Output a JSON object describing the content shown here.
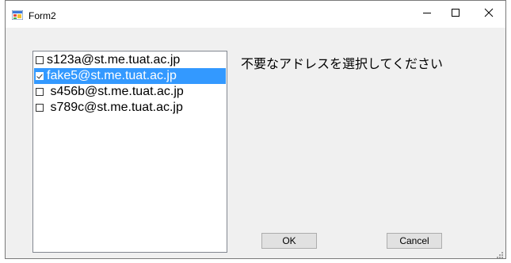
{
  "window": {
    "title": "Form2",
    "minimize_symbol": "–",
    "close_symbol": "✕"
  },
  "listbox": {
    "items": [
      {
        "label": "s123a@st.me.tuat.ac.jp",
        "checked": false,
        "selected": false
      },
      {
        "label": "fake5@st.me.tuat.ac.jp",
        "checked": true,
        "selected": true
      },
      {
        "label": " s456b@st.me.tuat.ac.jp",
        "checked": false,
        "selected": false
      },
      {
        "label": " s789c@st.me.tuat.ac.jp",
        "checked": false,
        "selected": false
      }
    ]
  },
  "prompt": "不要なアドレスを選択してください",
  "buttons": {
    "ok_label": "OK",
    "cancel_label": "Cancel"
  },
  "colors": {
    "selection": "#3399ff",
    "form_background": "#f0f0f0"
  },
  "icons": [
    "form-app-icon",
    "minimize-icon",
    "maximize-icon",
    "close-icon",
    "resize-grip-icon"
  ]
}
